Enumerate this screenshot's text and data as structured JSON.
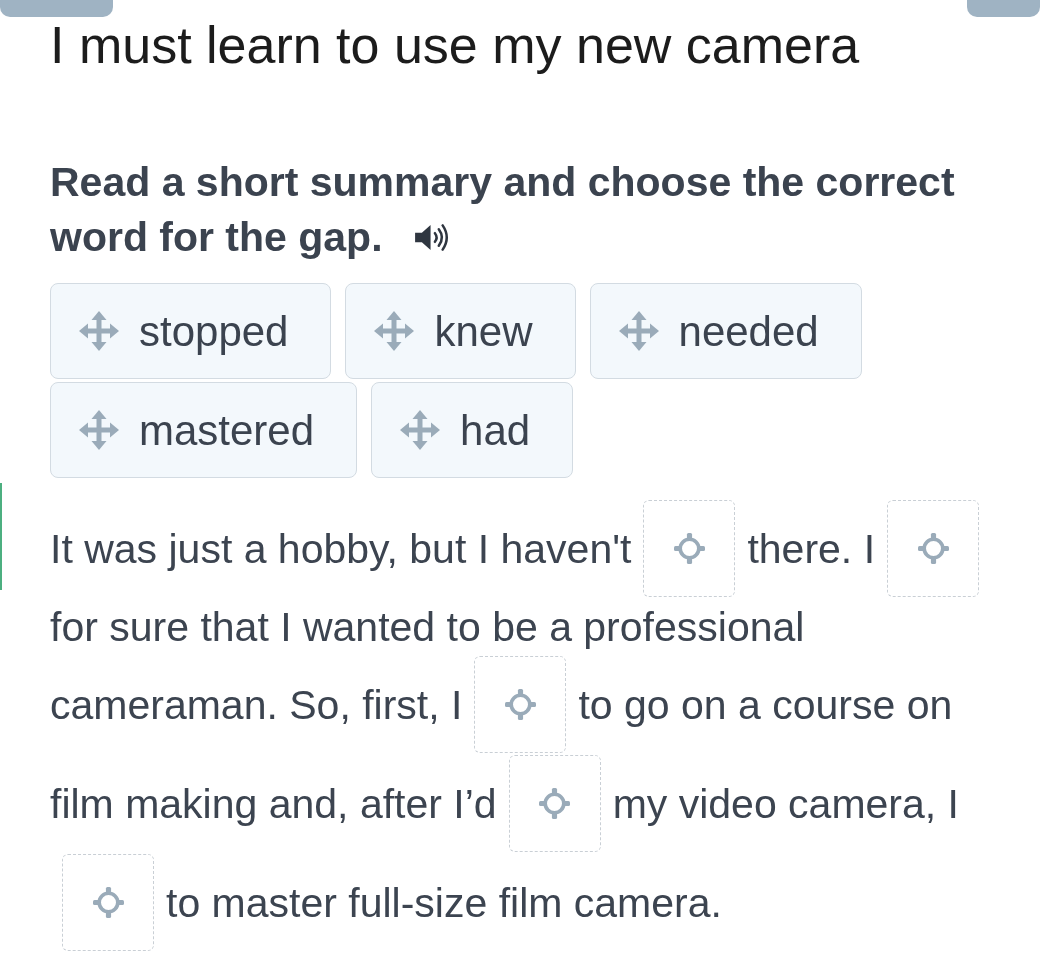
{
  "title": "I must learn to use my new camera",
  "instruction": {
    "lines": [
      "Read a short summary and choose the correct",
      "word for the gap."
    ]
  },
  "options": [
    "stopped",
    "knew",
    "needed",
    "mastered",
    "had"
  ],
  "passage": {
    "lines": [
      [
        {
          "kind": "text",
          "text": "It was just a hobby, but I haven't"
        },
        {
          "kind": "gap"
        },
        {
          "kind": "text",
          "text": "there. I"
        },
        {
          "kind": "gap"
        }
      ],
      [
        {
          "kind": "text",
          "text": "for sure that I wanted to be a professional"
        }
      ],
      [
        {
          "kind": "text",
          "text": "cameraman. So, first, I"
        },
        {
          "kind": "gap"
        },
        {
          "kind": "text",
          "text": "to go on a course on"
        }
      ],
      [
        {
          "kind": "text",
          "text": "film making and, after I’d"
        },
        {
          "kind": "gap"
        },
        {
          "kind": "text",
          "text": "my video camera, I"
        }
      ],
      [
        {
          "kind": "gap"
        },
        {
          "kind": "text",
          "text": "to master full-size film camera."
        }
      ]
    ]
  }
}
